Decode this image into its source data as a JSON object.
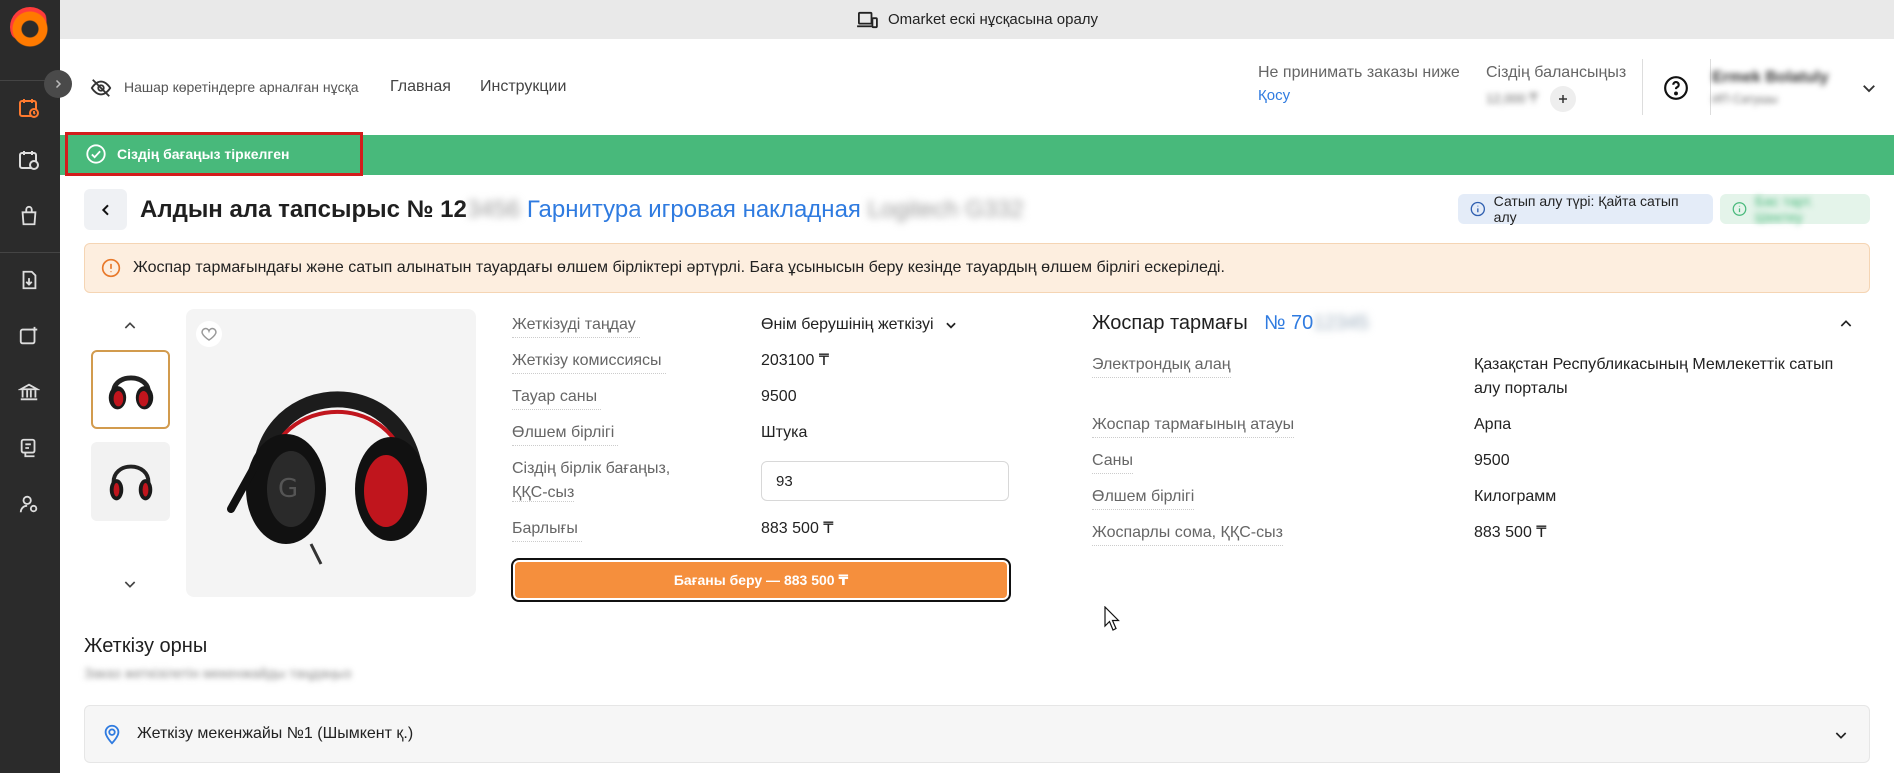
{
  "top_banner": {
    "text": "Omarket ескі нұсқасына оралу",
    "icon": "device-switch-icon"
  },
  "header": {
    "accessibility_label": "Нашар көретіндерге арналған нұсқа",
    "nav": [
      "Главная",
      "Инструкции"
    ],
    "min_order_label": "Не принимать заказы ниже",
    "min_order_link": "Қосу",
    "balance_label": "Сіздің балансыңыз",
    "balance_value": "12,000 ₸",
    "user_name": "Ermek Bolatuly",
    "user_role": "ИП Сатушы",
    "help_icon": "help-icon",
    "user_menu_icon": "chevron-down-icon"
  },
  "success_message": "Сіздің бағаңыз тіркелген",
  "order": {
    "title_prefix": "Алдын ала тапсырыс № 12",
    "title_hidden": "3456",
    "product_name": "Гарнитура игровая накладная",
    "product_hidden": "Logitech G332",
    "purchase_type_chip": "Сатып алу түрі: Қайта сатып алу",
    "status_chip": "Бас тарт. Шектеу"
  },
  "warning": "Жоспар тармағындағы және сатып алынатын тауардағы өлшем бірліктері әртүрлі. Баға ұсынысын беру кезінде тауардың өлшем бірлігі ескеріледі.",
  "details": {
    "rows": [
      {
        "label": "Жеткізуді таңдау",
        "value": "Өнім берушінің жеткізуі"
      },
      {
        "label": "Жеткізу комиссиясы",
        "value": "203100 ₸"
      },
      {
        "label": "Тауар саны",
        "value": "9500"
      },
      {
        "label": "Өлшем бірлігі",
        "value": "Штука"
      }
    ],
    "price_label_1": "Сіздің бірлік бағаңыз,",
    "price_label_2": "ҚҚС-сыз",
    "price_value": "93",
    "total_label": "Барлығы",
    "total_value": "883 500 ₸",
    "submit_label": "Бағаны беру — 883 500 ₸"
  },
  "plan": {
    "title": "Жоспар тармағы",
    "number": "№ 70",
    "number_hidden": "12345",
    "rows": [
      {
        "label": "Электрондық алаң",
        "value": "Қазақстан Республикасының Мемлекеттік сатып алу порталы"
      },
      {
        "label": "Жоспар тармағының атауы",
        "value": "Арпа"
      },
      {
        "label": "Саны",
        "value": "9500"
      },
      {
        "label": "Өлшем бірлігі",
        "value": "Килограмм"
      },
      {
        "label": "Жоспарлы сома, ҚҚС-сыз",
        "value": "883 500 ₸"
      }
    ]
  },
  "delivery": {
    "title": "Жеткізу орны",
    "subtitle": "Заказ жеткізілетін мекенжайды таңдаңыз",
    "address": "Жеткізу мекенжайы №1 (Шымкент қ.)"
  },
  "colors": {
    "brand_orange": "#f58f3d",
    "success_green": "#48b97b",
    "link_blue": "#2f7be0",
    "sidebar": "#2b2b2b"
  }
}
